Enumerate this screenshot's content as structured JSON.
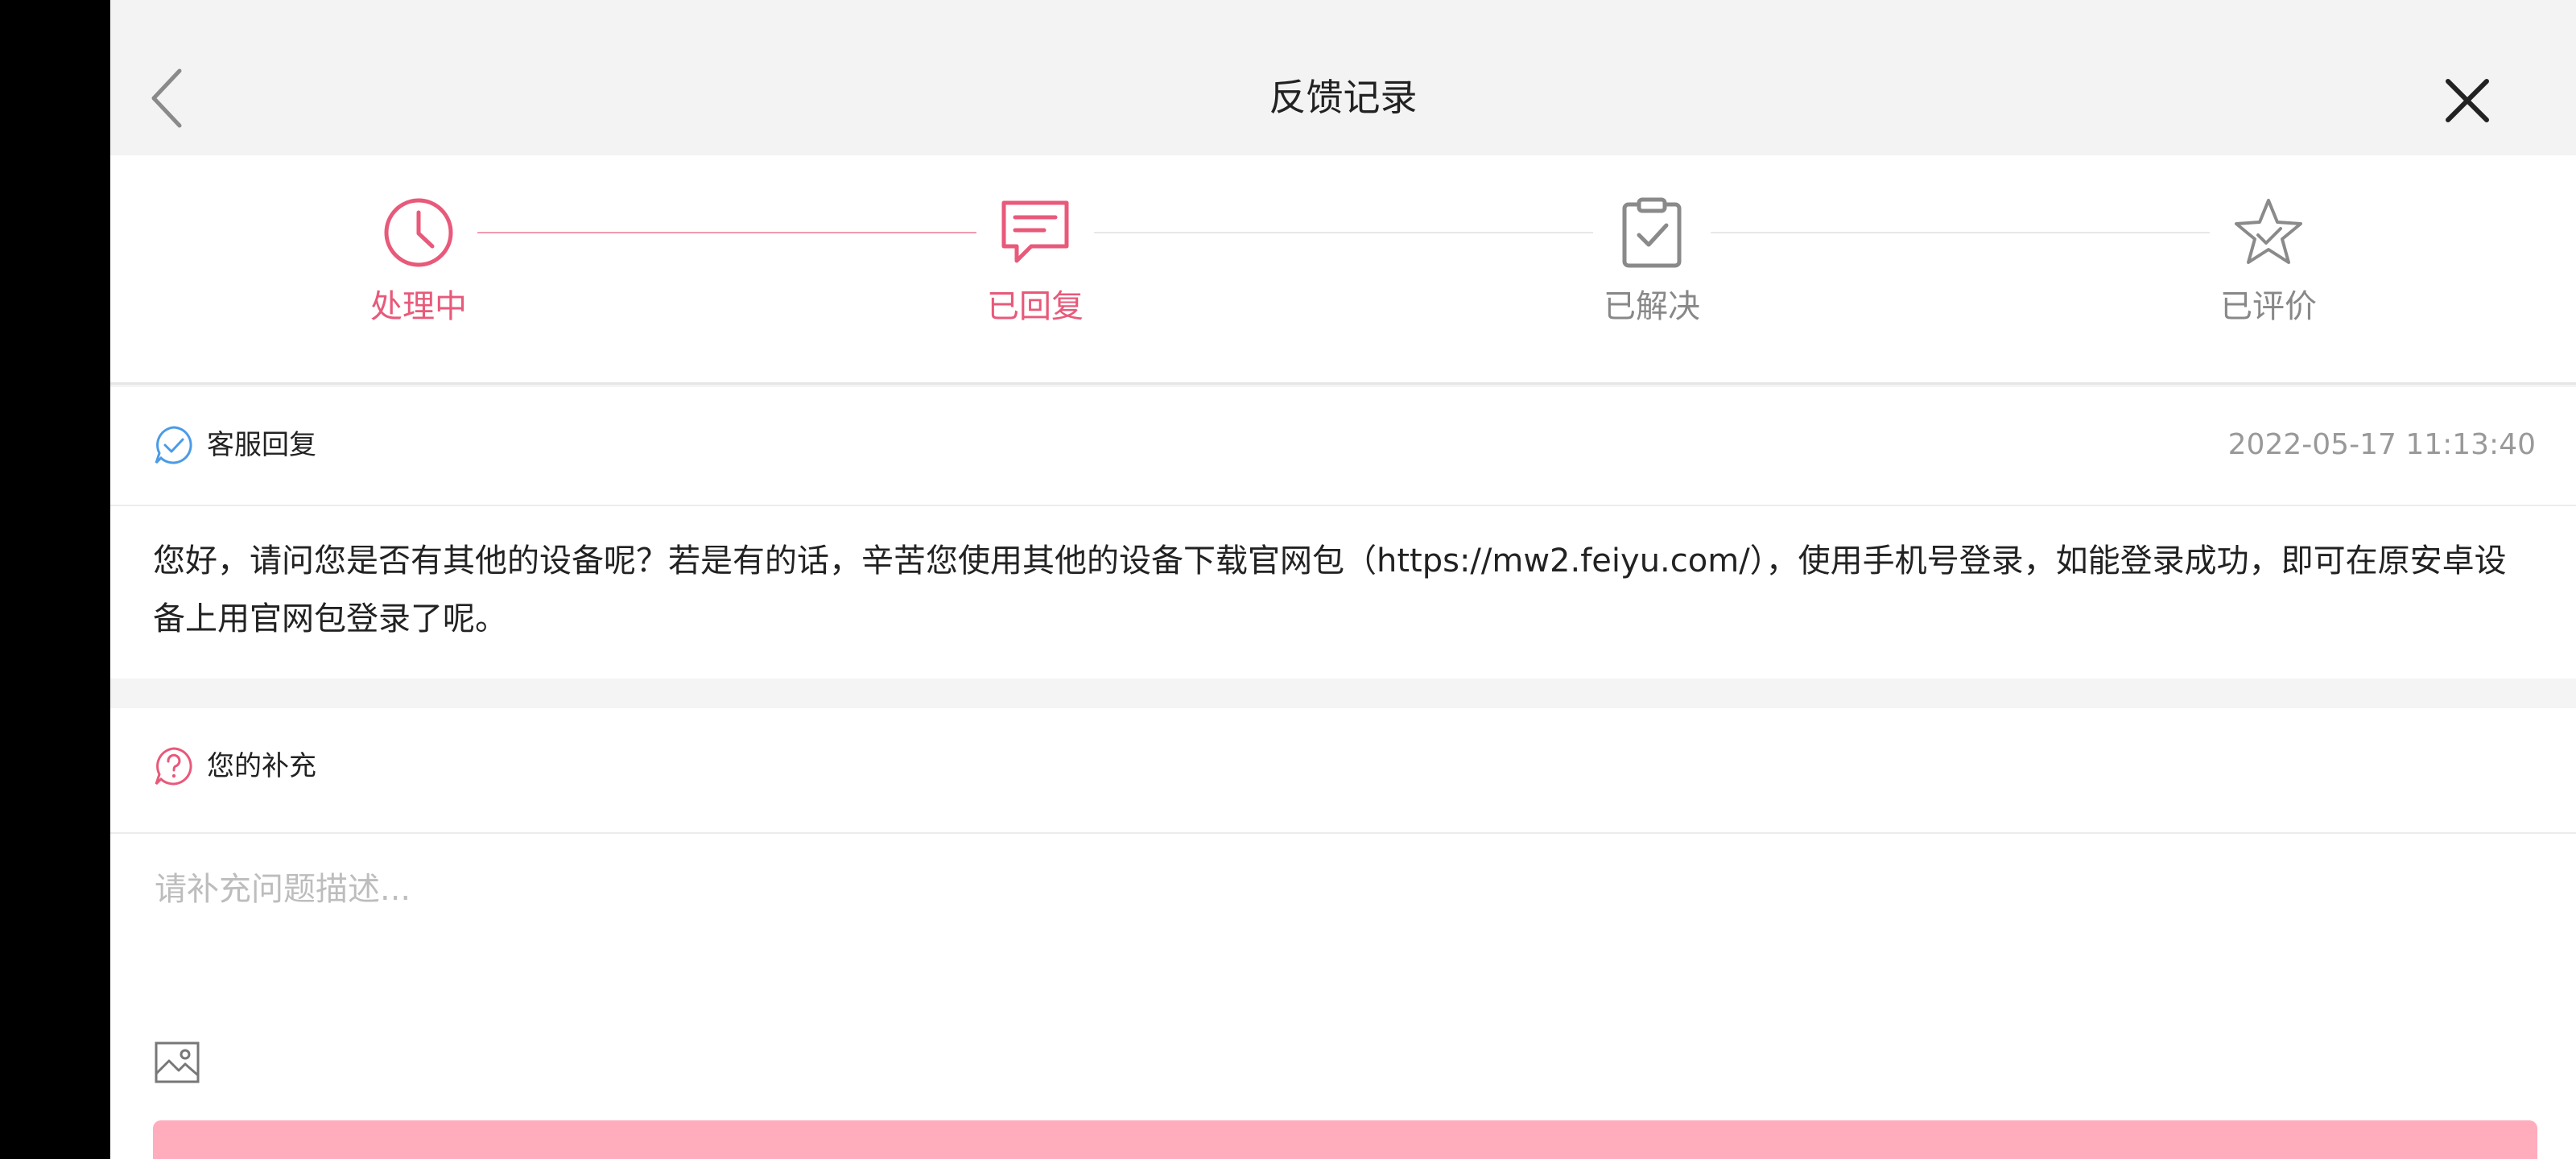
{
  "header": {
    "title": "反馈记录"
  },
  "steps": [
    {
      "label": "处理中",
      "icon": "clock-icon",
      "state": "active"
    },
    {
      "label": "已回复",
      "icon": "message-icon",
      "state": "active"
    },
    {
      "label": "已解决",
      "icon": "clipboard-check-icon",
      "state": "inactive"
    },
    {
      "label": "已评价",
      "icon": "star-check-icon",
      "state": "inactive"
    }
  ],
  "reply": {
    "label": "客服回复",
    "time": "2022-05-17 11:13:40",
    "body": "您好，请问您是否有其他的设备呢？若是有的话，辛苦您使用其他的设备下载官网包（https://mw2.feiyu.com/），使用手机号登录，如能登录成功，即可在原安卓设备上用官网包登录了呢。"
  },
  "supplement": {
    "label": "您的补充",
    "placeholder": "请补充问题描述..."
  },
  "colors": {
    "accent": "#e8597a",
    "submit": "#ffadbc",
    "reply_icon": "#4a9be8"
  }
}
